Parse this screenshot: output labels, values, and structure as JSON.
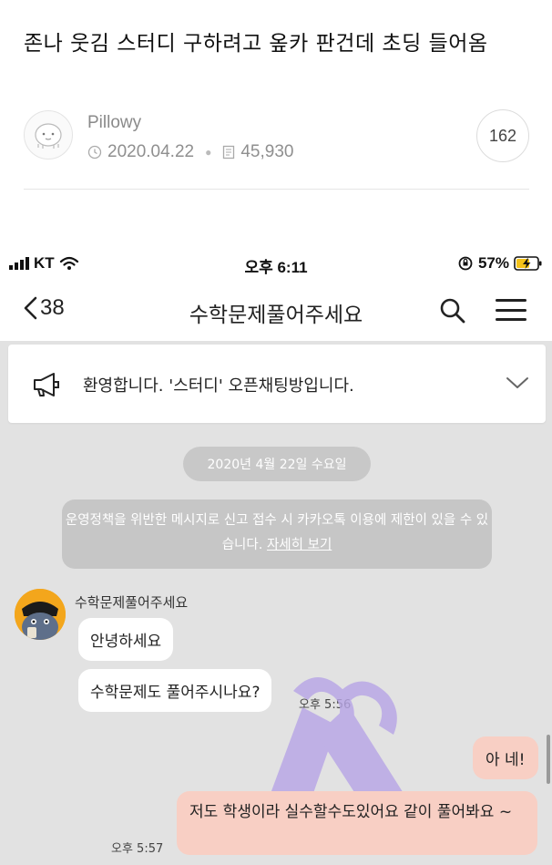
{
  "post": {
    "title": "존나 웃김 스터디 구하려고 옾카 판건데 초딩 들어옴",
    "author": "Pillowy",
    "date": "2020.04.22",
    "views": "45,930",
    "comment_count": "162"
  },
  "status_bar": {
    "carrier": "KT",
    "time": "오후 6:11",
    "battery": "57%"
  },
  "chat_header": {
    "back_count": "38",
    "title": "수학문제풀어주세요"
  },
  "notice": {
    "text": "환영합니다. '스터디' 오픈채팅방입니다."
  },
  "chat": {
    "date_divider": "2020년 4월 22일 수요일",
    "policy_text": "운영정책을 위반한 메시지로 신고 접수 시 카카오톡 이용에 제한이 있을 수 있습니다.",
    "policy_link": "자세히 보기",
    "messages": [
      {
        "sender": "수학문제풀어주세요",
        "text": "안녕하세요"
      },
      {
        "sender": "수학문제풀어주세요",
        "text": "수학문제도 풀어주시나요?",
        "time": "오후 5:56"
      },
      {
        "sender": "me",
        "text": "아 네!"
      },
      {
        "sender": "me",
        "text": "저도 학생이라 실수할수도있어요 같이 풀어봐요 ~",
        "time": "오후 5:57"
      }
    ]
  },
  "colors": {
    "chat_background": "#e2e2e2",
    "my_bubble": "#f8cfc4",
    "their_bubble": "#ffffff",
    "ribbon": "#b8a6e6",
    "avatar": "#f3a61c"
  }
}
